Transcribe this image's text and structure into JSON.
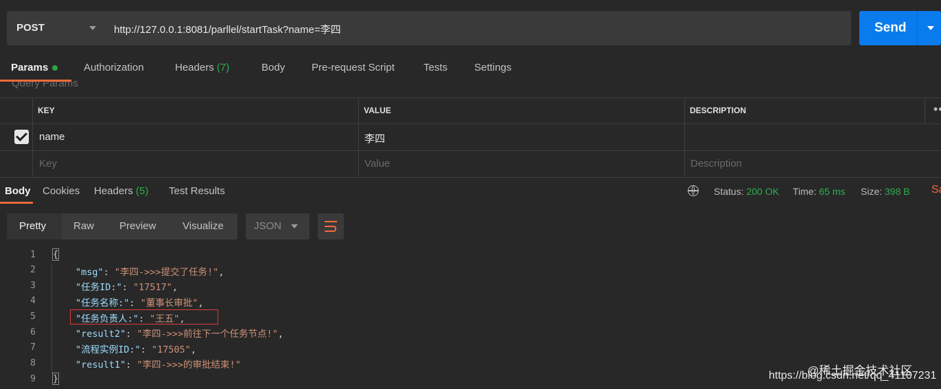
{
  "request": {
    "method": "POST",
    "url": "http://127.0.0.1:8081/parllel/startTask?name=李四",
    "send_label": "Send"
  },
  "request_tabs": [
    {
      "label": "Params",
      "active": true
    },
    {
      "label": "Authorization"
    },
    {
      "label": "Headers",
      "count": "(7)"
    },
    {
      "label": "Body"
    },
    {
      "label": "Pre-request Script"
    },
    {
      "label": "Tests"
    },
    {
      "label": "Settings"
    }
  ],
  "query_params": {
    "label": "Query Params",
    "headers": {
      "key": "KEY",
      "value": "VALUE",
      "description": "DESCRIPTION"
    },
    "rows": [
      {
        "checked": true,
        "key": "name",
        "value": "李四",
        "description": ""
      }
    ],
    "placeholders": {
      "key": "Key",
      "value": "Value",
      "description": "Description"
    }
  },
  "response_tabs": [
    {
      "label": "Body",
      "active": true
    },
    {
      "label": "Cookies"
    },
    {
      "label": "Headers",
      "count": "(5)"
    },
    {
      "label": "Test Results"
    }
  ],
  "response_meta": {
    "status_label": "Status:",
    "status_value": "200 OK",
    "time_label": "Time:",
    "time_value": "65 ms",
    "size_label": "Size:",
    "size_value": "398 B",
    "save_fragment": "Sa"
  },
  "view_modes": [
    "Pretty",
    "Raw",
    "Preview",
    "Visualize"
  ],
  "format": "JSON",
  "code": {
    "line_numbers": [
      "1",
      "2",
      "3",
      "4",
      "5",
      "6",
      "7",
      "8",
      "9"
    ],
    "open_brace": "{",
    "close_brace": "}",
    "entries": [
      {
        "key": "\"msg\"",
        "value": "\"李四->>>提交了任务!\"",
        "suffix": ","
      },
      {
        "key": "\"任务ID:\"",
        "value": "\"17517\"",
        "suffix": ","
      },
      {
        "key": "\"任务名称:\"",
        "value": "\"董事长审批\"",
        "suffix": ","
      },
      {
        "key": "\"任务负责人:\"",
        "value": "\"王五\"",
        "suffix": ","
      },
      {
        "key": "\"result2\"",
        "value": "\"李四->>>前往下一个任务节点!\"",
        "suffix": ","
      },
      {
        "key": "\"流程实例ID:\"",
        "value": "\"17505\"",
        "suffix": ","
      },
      {
        "key": "\"result1\"",
        "value": "\"李四->>>的审批结束!\"",
        "suffix": ""
      }
    ]
  },
  "watermark": {
    "line1": "@稀土掘金技术社区",
    "line2": "https://blog.csdn.net/qq_41107231"
  },
  "colors": {
    "accent": "#f26b3a",
    "send": "#097bed",
    "success": "#2db04e",
    "highlight": "#e23b3b"
  }
}
